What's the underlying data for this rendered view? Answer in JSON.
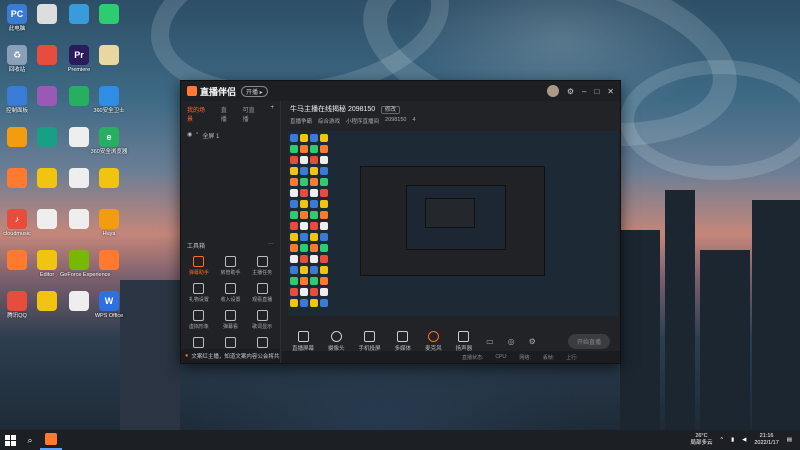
{
  "desktop_icons": [
    {
      "label": "此电脑",
      "sub": "",
      "color": "#3a7bd5",
      "glyph": "PC"
    },
    {
      "label": "",
      "sub": "",
      "color": "#dddddd",
      "glyph": ""
    },
    {
      "label": "",
      "sub": "",
      "color": "#3a9bdc",
      "glyph": ""
    },
    {
      "label": "",
      "sub": "",
      "color": "#2ecc71",
      "glyph": ""
    },
    {
      "label": "回收站",
      "sub": "",
      "color": "#8aa0b8",
      "glyph": "♻"
    },
    {
      "label": "",
      "sub": "",
      "color": "#e74c3c",
      "glyph": ""
    },
    {
      "label": "Premiere",
      "sub": "",
      "color": "#2b1b5c",
      "glyph": "Pr"
    },
    {
      "label": "",
      "sub": "",
      "color": "#e8d7a0",
      "glyph": ""
    },
    {
      "label": "控制面板",
      "sub": "",
      "color": "#3a7bd5",
      "glyph": ""
    },
    {
      "label": "",
      "sub": "",
      "color": "#9b59b6",
      "glyph": ""
    },
    {
      "label": "",
      "sub": "",
      "color": "#27ae60",
      "glyph": ""
    },
    {
      "label": "360安全卫士",
      "sub": "",
      "color": "#2f8de4",
      "glyph": ""
    },
    {
      "label": "",
      "sub": "",
      "color": "#f39c12",
      "glyph": ""
    },
    {
      "label": "",
      "sub": "",
      "color": "#16a085",
      "glyph": ""
    },
    {
      "label": "",
      "sub": "",
      "color": "#eeeeee",
      "glyph": ""
    },
    {
      "label": "360安全浏览器",
      "sub": "",
      "color": "#27ae60",
      "glyph": "e"
    },
    {
      "label": "",
      "sub": "",
      "color": "#ff7a2f",
      "glyph": ""
    },
    {
      "label": "",
      "sub": "",
      "color": "#f1c40f",
      "glyph": ""
    },
    {
      "label": "",
      "sub": "",
      "color": "#eeeeee",
      "glyph": ""
    },
    {
      "label": "",
      "sub": "",
      "color": "#f1c40f",
      "glyph": ""
    },
    {
      "label": "cloudmusic",
      "sub": "",
      "color": "#e74c3c",
      "glyph": "♪"
    },
    {
      "label": "",
      "sub": "",
      "color": "#eeeeee",
      "glyph": ""
    },
    {
      "label": "",
      "sub": "",
      "color": "#eeeeee",
      "glyph": ""
    },
    {
      "label": "Huya",
      "sub": "",
      "color": "#f39c12",
      "glyph": ""
    },
    {
      "label": "",
      "sub": "",
      "color": "#ff7a2f",
      "glyph": ""
    },
    {
      "label": "Editor",
      "sub": "",
      "color": "#f1c40f",
      "glyph": ""
    },
    {
      "label": "GeForce Experience",
      "sub": "",
      "color": "#76b900",
      "glyph": ""
    },
    {
      "label": "",
      "sub": "",
      "color": "#ff7a2f",
      "glyph": ""
    },
    {
      "label": "腾讯QQ",
      "sub": "",
      "color": "#e74c3c",
      "glyph": ""
    },
    {
      "label": "",
      "sub": "",
      "color": "#f1c40f",
      "glyph": ""
    },
    {
      "label": "",
      "sub": "",
      "color": "#eeeeee",
      "glyph": ""
    },
    {
      "label": "WPS Office",
      "sub": "",
      "color": "#2f6fe4",
      "glyph": "W"
    }
  ],
  "app": {
    "name": "直播伴侣",
    "pill": "开播 ▸",
    "left_tabs": [
      "我的场景",
      "直播",
      "可直播"
    ],
    "scene_label": "全屏 1",
    "tools_title": "工具箱",
    "tools_more": "···",
    "tools": [
      "弹幕助手",
      "房管助手",
      "主播任务",
      "礼物设置",
      "收入设置",
      "观看直播",
      "虚拟形象",
      "弹幕看",
      "歌词显示",
      "",
      "",
      ""
    ],
    "notice": "文案红主播，知道文案内容公会将共享抖音群，请立即联系与您服务",
    "stream_title": "牛马主播在线揭秘 2098150",
    "edit_chip": "修改",
    "row2": [
      "直播争霸",
      "综合游戏",
      "小程序直播间",
      "2098150",
      "4"
    ],
    "controls": [
      "直播屏幕",
      "摄像头",
      "手机投屏",
      "多媒体",
      "麦克风",
      "扬声器"
    ],
    "start_button": "开始直播",
    "status_items": [
      "直播状态:",
      "CPU:",
      "网络:",
      "丢帧:",
      "上行:"
    ]
  },
  "taskbar": {
    "weather_temp": "26°C",
    "weather_desc": "局部多云",
    "time": "21:16",
    "date": "2022/1/17"
  }
}
